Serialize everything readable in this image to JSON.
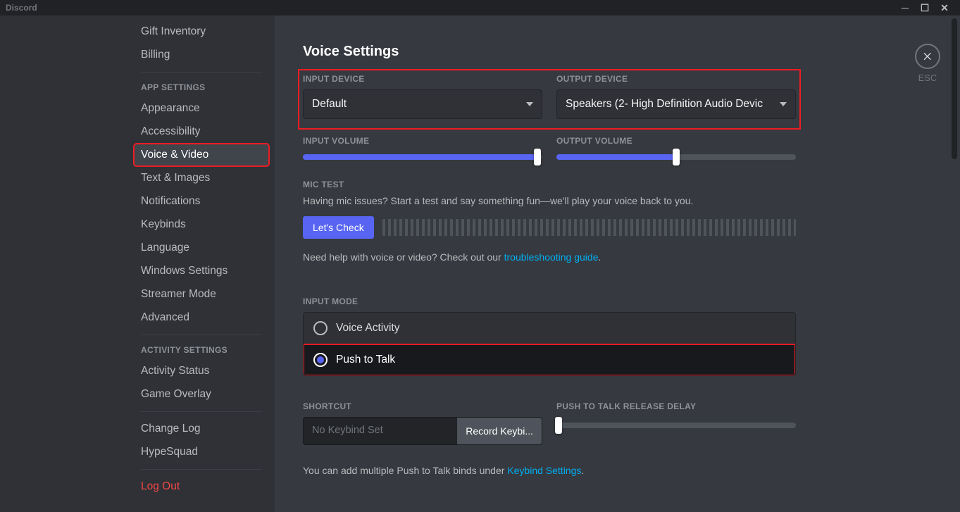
{
  "app": {
    "name": "Discord"
  },
  "close": {
    "esc": "ESC"
  },
  "sidebar": {
    "items_top": [
      {
        "label": "Gift Inventory"
      },
      {
        "label": "Billing"
      }
    ],
    "header_app": "APP SETTINGS",
    "items_app": [
      {
        "label": "Appearance"
      },
      {
        "label": "Accessibility"
      },
      {
        "label": "Voice & Video",
        "selected": true
      },
      {
        "label": "Text & Images"
      },
      {
        "label": "Notifications"
      },
      {
        "label": "Keybinds"
      },
      {
        "label": "Language"
      },
      {
        "label": "Windows Settings"
      },
      {
        "label": "Streamer Mode"
      },
      {
        "label": "Advanced"
      }
    ],
    "header_activity": "ACTIVITY SETTINGS",
    "items_activity": [
      {
        "label": "Activity Status"
      },
      {
        "label": "Game Overlay"
      }
    ],
    "items_bottom": [
      {
        "label": "Change Log"
      },
      {
        "label": "HypeSquad"
      }
    ],
    "logout": "Log Out"
  },
  "page": {
    "title": "Voice Settings",
    "input_device_label": "INPUT DEVICE",
    "output_device_label": "OUTPUT DEVICE",
    "input_device_value": "Default",
    "output_device_value": "Speakers (2- High Definition Audio Devic",
    "input_volume_label": "INPUT VOLUME",
    "output_volume_label": "OUTPUT VOLUME",
    "input_volume_pct": 98,
    "output_volume_pct": 50,
    "mic_test_label": "MIC TEST",
    "mic_test_desc": "Having mic issues? Start a test and say something fun—we'll play your voice back to you.",
    "lets_check": "Let's Check",
    "help_prefix": "Need help with voice or video? Check out our ",
    "help_link": "troubleshooting guide",
    "input_mode_label": "INPUT MODE",
    "mode_voice": "Voice Activity",
    "mode_ptt": "Push to Talk",
    "shortcut_label": "SHORTCUT",
    "shortcut_placeholder": "No Keybind Set",
    "record_btn": "Record Keybi...",
    "ptt_delay_label": "PUSH TO TALK RELEASE DELAY",
    "ptt_delay_pct": 1,
    "note_prefix": "You can add multiple Push to Talk binds under ",
    "note_link": "Keybind Settings"
  }
}
